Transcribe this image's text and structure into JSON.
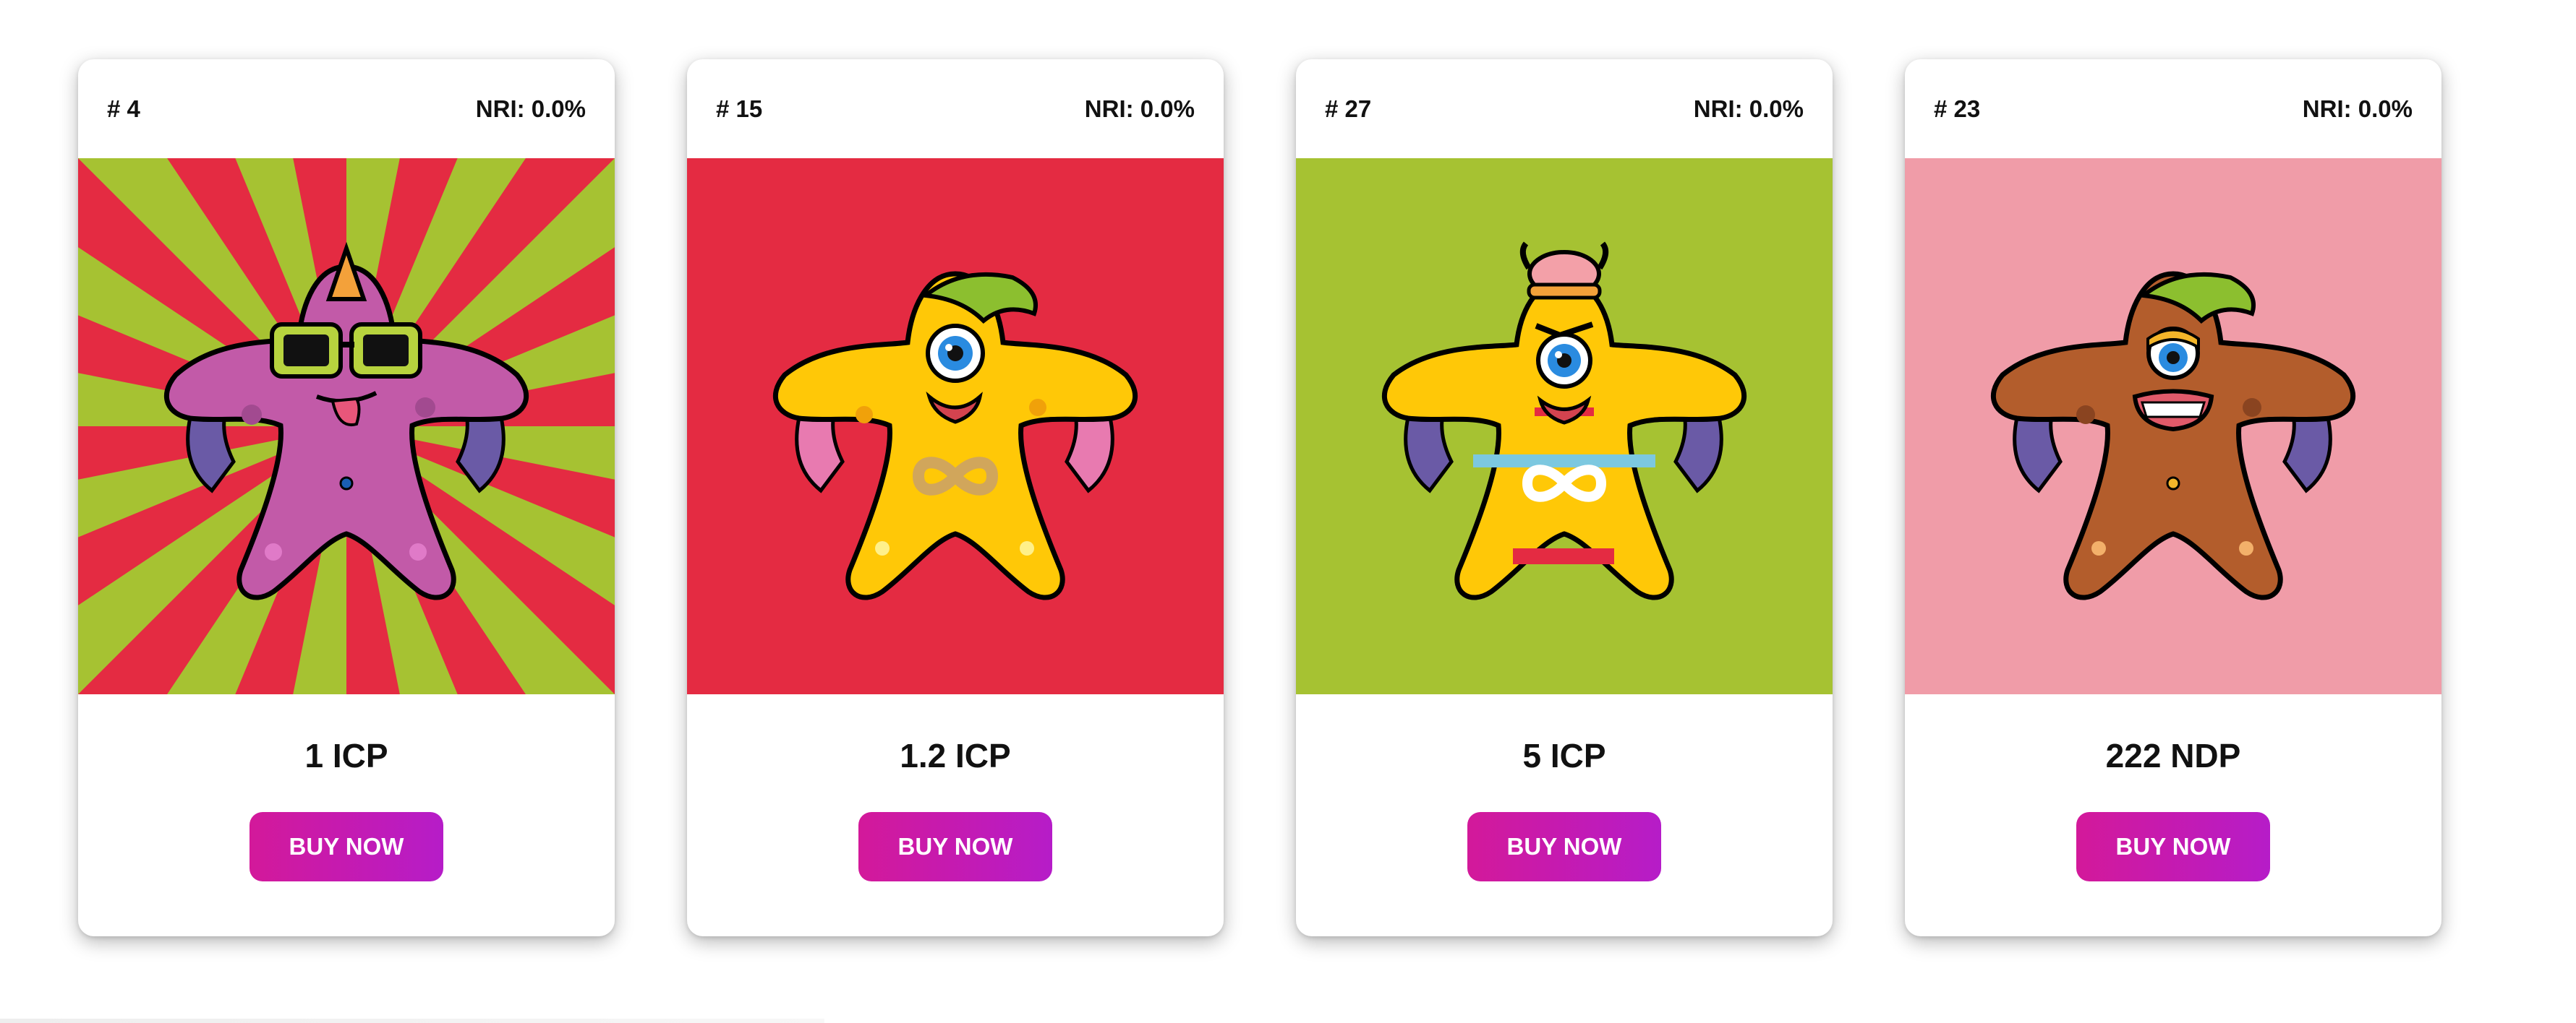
{
  "cards": [
    {
      "number": "# 4",
      "nri": "NRI: 0.0%",
      "price": "1 ICP",
      "buy_label": "BUY NOW",
      "background": "sunburst-red-green",
      "body_color": "#c25aa8",
      "character": "purple starfish with orange unicorn horn and green sunglasses, tongue out"
    },
    {
      "number": "# 15",
      "nri": "NRI: 0.0%",
      "price": "1.2 ICP",
      "buy_label": "BUY NOW",
      "background": "#e42b42",
      "body_color": "#ffc807",
      "character": "yellow one-eyed starfish with green leaf hair and pink tentacle arms, infinity logo"
    },
    {
      "number": "# 27",
      "nri": "NRI: 0.0%",
      "price": "5 ICP",
      "buy_label": "BUY NOW",
      "background": "#a6c232",
      "body_color": "#ffc807",
      "character": "yellow striped one-eyed starfish with pink viking helmet, infinity logo"
    },
    {
      "number": "# 23",
      "nri": "NRI: 0.0%",
      "price": "222 NDP",
      "buy_label": "BUY NOW",
      "background": "#f09ca8",
      "body_color": "#b35d2c",
      "character": "brown one-eyed starfish with green leaf hair and wide grin"
    }
  ],
  "colors": {
    "button_gradient_start": "#d3199a",
    "button_gradient_end": "#b61cc8",
    "text": "#111111",
    "sunburst_red": "#e42b42",
    "sunburst_green": "#a6c232"
  }
}
